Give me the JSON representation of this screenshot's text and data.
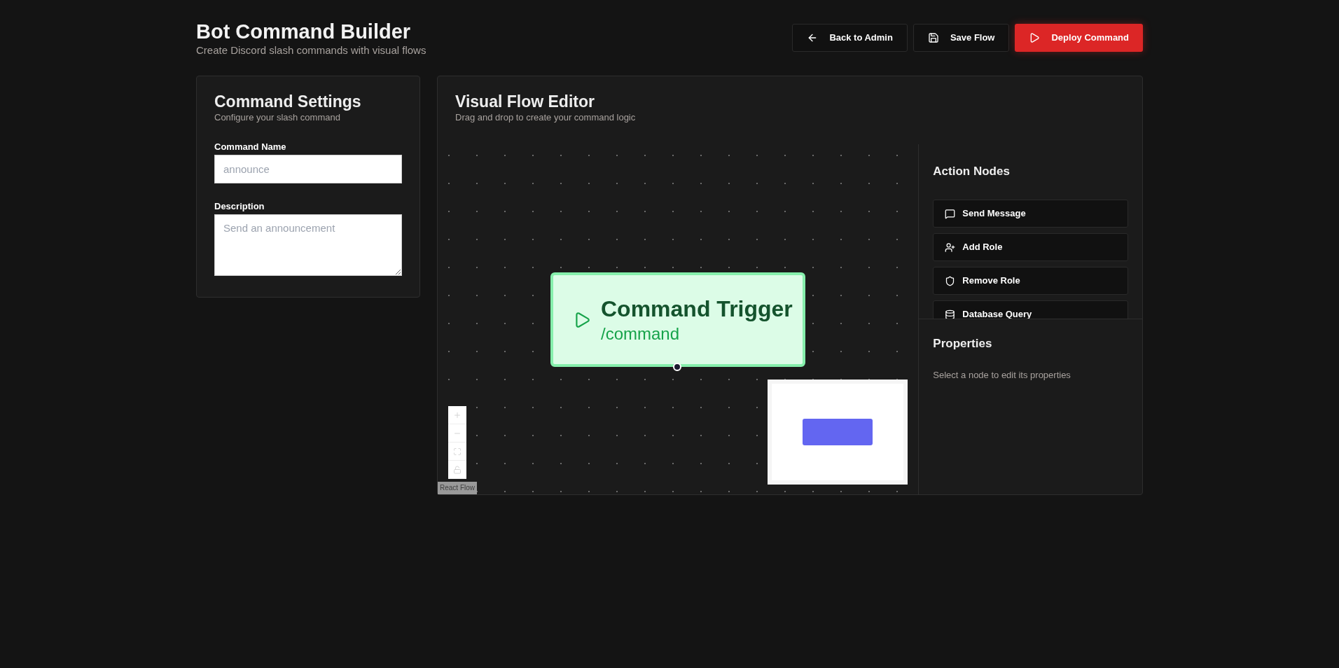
{
  "header": {
    "title": "Bot Command Builder",
    "subtitle": "Create Discord slash commands with visual flows",
    "buttons": [
      {
        "label": "Back to Admin",
        "kind": "back"
      },
      {
        "label": "Save Flow",
        "kind": "save"
      },
      {
        "label": "Deploy Command",
        "kind": "deploy"
      }
    ]
  },
  "settings": {
    "title": "Command Settings",
    "subtitle": "Configure your slash command",
    "fields": [
      {
        "label": "Command Name",
        "placeholder": "announce",
        "kind": "input"
      },
      {
        "label": "Description",
        "placeholder": "Send an announcement",
        "kind": "textarea"
      }
    ]
  },
  "editor": {
    "title": "Visual Flow Editor",
    "subtitle": "Drag and drop to create your command logic",
    "trigger_node": {
      "title": "Command Trigger",
      "command": "/command"
    },
    "attribution": "React Flow"
  },
  "action_nodes": {
    "title": "Action Nodes",
    "items": [
      {
        "label": "Send Message",
        "kind": "message"
      },
      {
        "label": "Add Role",
        "kind": "add_role"
      },
      {
        "label": "Remove Role",
        "kind": "remove_role"
      },
      {
        "label": "Database Query",
        "kind": "database"
      }
    ]
  },
  "properties": {
    "title": "Properties",
    "hint": "Select a node to edit its properties"
  }
}
